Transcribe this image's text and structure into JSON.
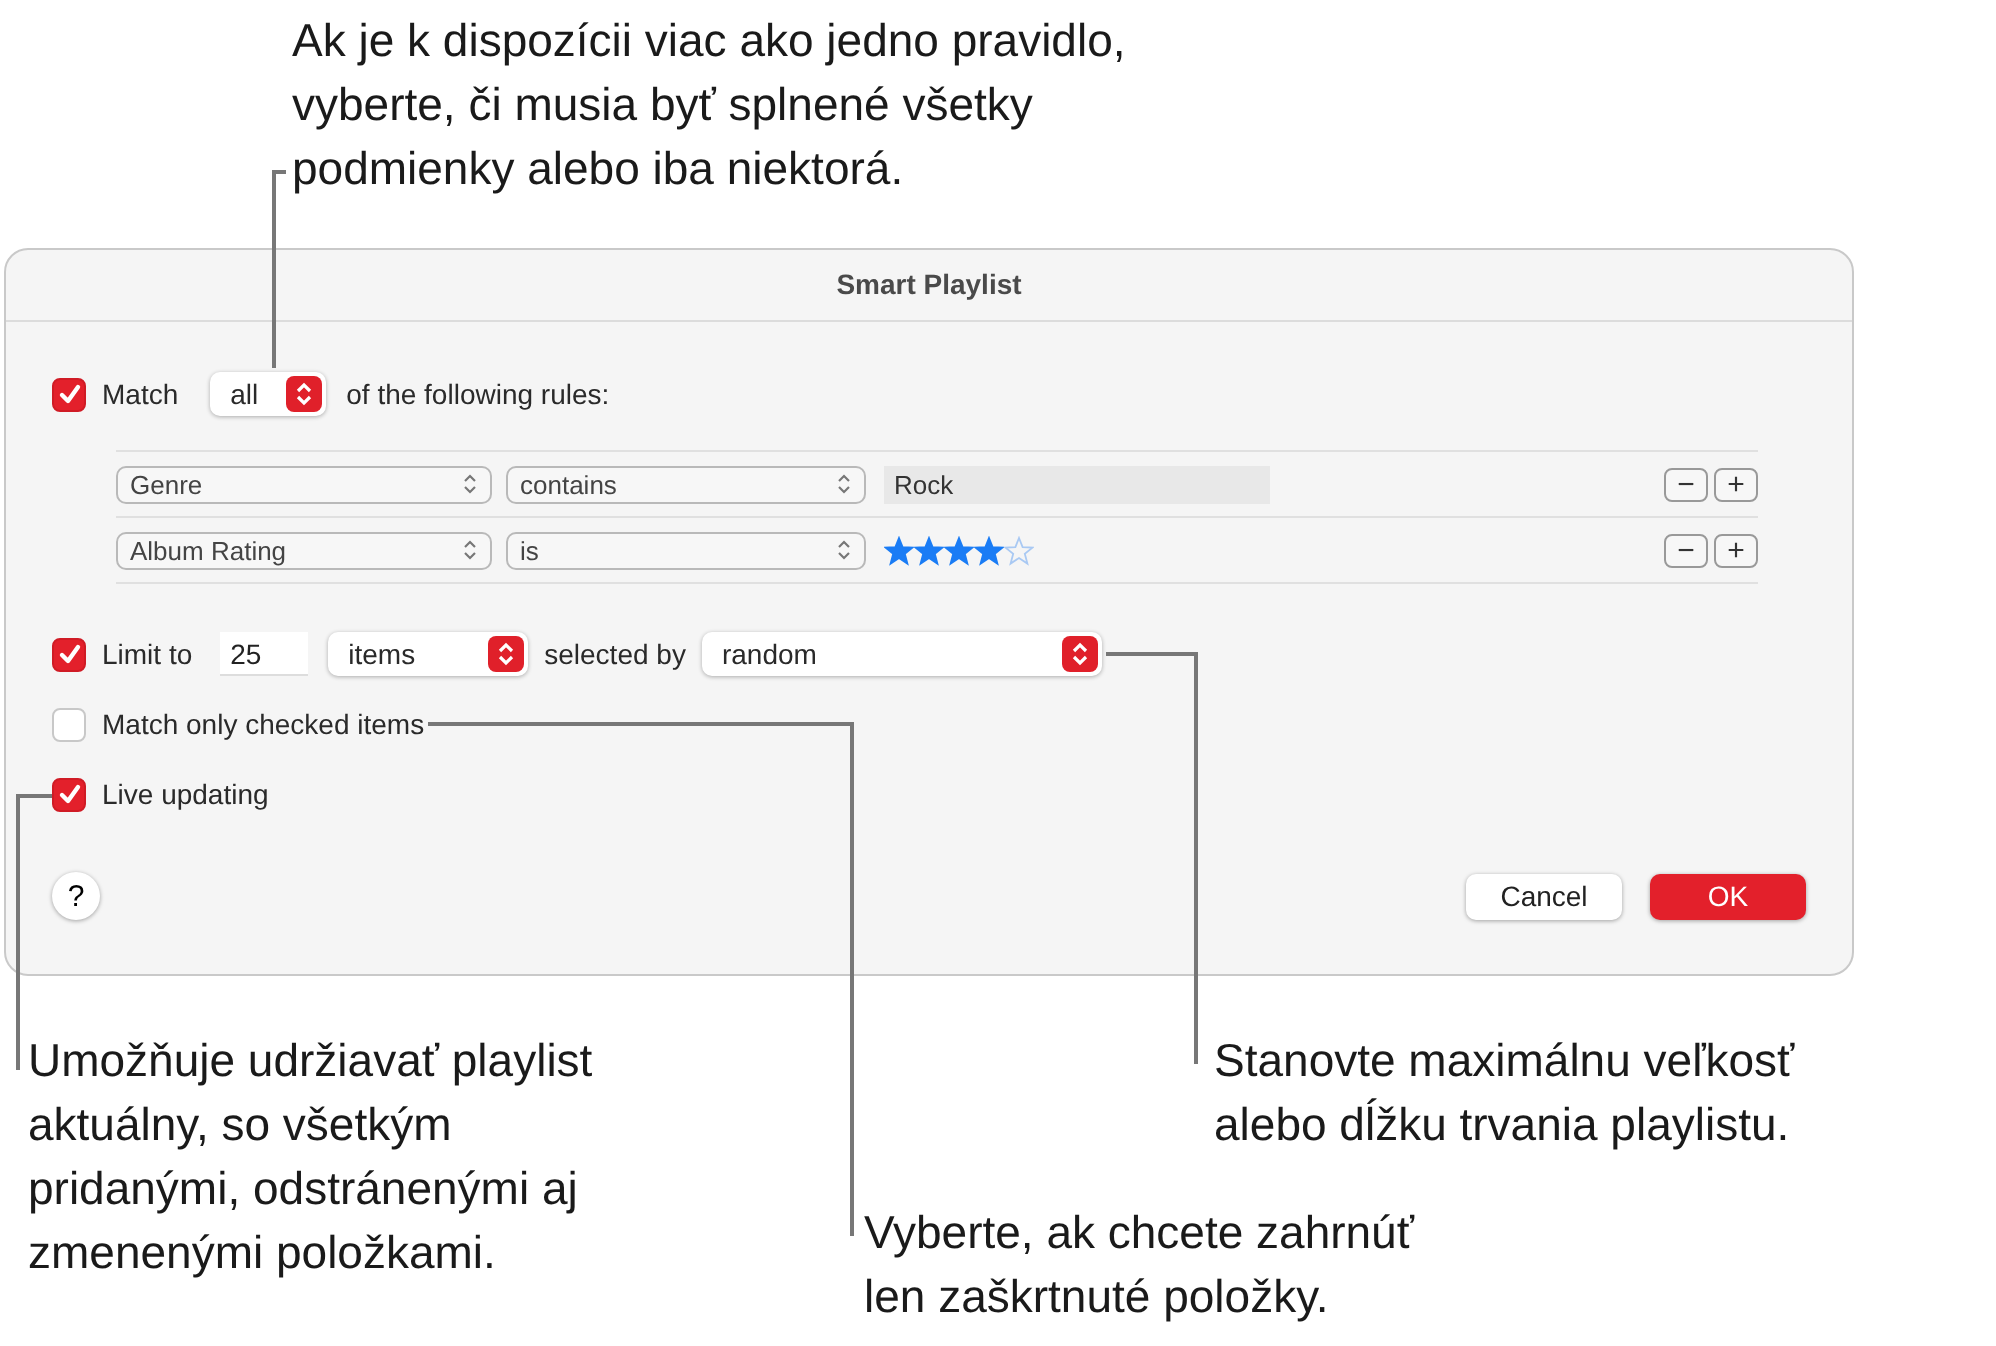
{
  "callouts": [
    {
      "lines": [
        "Ak je k dispozícii viac ako jedno pravidlo,",
        "vyberte, či musia byť splnené všetky",
        "podmienky alebo iba niektorá."
      ]
    },
    {
      "lines": [
        "Umožňuje udržiavať playlist",
        "aktuálny, so všetkým",
        "pridanými, odstránenými aj",
        "zmenenými položkami."
      ]
    },
    {
      "lines": [
        "Vyberte, ak chcete zahrnúť",
        "len zaškrtnuté položky."
      ]
    },
    {
      "lines": [
        "Stanovte maximálnu veľkosť",
        "alebo dĺžku trvania playlistu."
      ]
    }
  ],
  "dialog": {
    "title": "Smart Playlist",
    "match": {
      "checked": true,
      "label": "Match",
      "popup": "all",
      "suffix": "of the following rules:"
    },
    "rules": [
      {
        "kind": "text",
        "field": "Genre",
        "operator": "contains",
        "value": "Rock",
        "remove": "−",
        "add": "+"
      },
      {
        "kind": "stars",
        "field": "Album Rating",
        "operator": "is",
        "stars": 4,
        "remove": "−",
        "add": "+"
      }
    ],
    "limit": {
      "checked": true,
      "label": "Limit to",
      "value": "25",
      "unit": "items",
      "selected_by": "selected by",
      "method": "random"
    },
    "match_checked": {
      "checked": false,
      "label": "Match only checked items"
    },
    "live_updating": {
      "checked": true,
      "label": "Live updating"
    },
    "help": "?",
    "buttons": [
      {
        "label": "Cancel",
        "default": false
      },
      {
        "label": "OK",
        "default": true
      }
    ]
  }
}
